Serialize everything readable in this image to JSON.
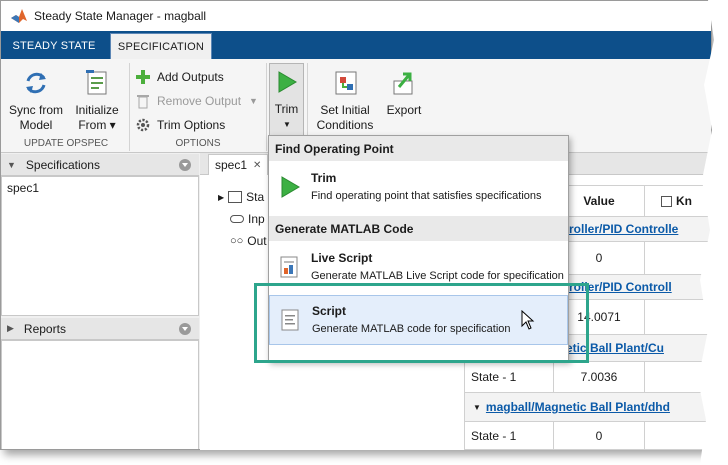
{
  "window": {
    "title": "Steady State Manager - magball"
  },
  "tabs": [
    {
      "label": "STEADY STATE",
      "active": false
    },
    {
      "label": "SPECIFICATION",
      "active": true
    }
  ],
  "toolstrip": {
    "sync": {
      "line1": "Sync from",
      "line2": "Model"
    },
    "initialize": {
      "line1": "Initialize",
      "line2": "From ▾"
    },
    "add_outputs": "Add Outputs",
    "remove_output": "Remove Output",
    "trim_options": "Trim Options",
    "trim": {
      "label": "Trim"
    },
    "set_initial": {
      "line1": "Set Initial",
      "line2": "Conditions"
    },
    "export": "Export",
    "groups": {
      "update": "UPDATE OPSPEC",
      "options": "OPTIONS"
    }
  },
  "specifications_panel": {
    "title": "Specifications",
    "items": [
      "spec1"
    ]
  },
  "reports_panel": {
    "title": "Reports"
  },
  "document": {
    "tab_label": "spec1",
    "tree": [
      "Sta",
      "Inp",
      "Out"
    ],
    "columns": {
      "value": "Value",
      "known": "Kn"
    },
    "rows": [
      {
        "kind": "link",
        "text": "roller/PID Controlle"
      },
      {
        "kind": "value",
        "value": "0"
      },
      {
        "kind": "link",
        "text": "roller/PID Controll"
      },
      {
        "kind": "value",
        "value": "14.0071"
      },
      {
        "kind": "block",
        "text": "magball/Magnetic Ball Plant/Cu"
      },
      {
        "kind": "state",
        "name": "State - 1",
        "value": "7.0036"
      },
      {
        "kind": "block",
        "text": "magball/Magnetic Ball Plant/dhd"
      },
      {
        "kind": "state",
        "name": "State - 1",
        "value": "0"
      }
    ]
  },
  "menu": {
    "section1": "Find Operating Point",
    "trim": {
      "title": "Trim",
      "desc": "Find operating point that satisfies specifications"
    },
    "section2": "Generate MATLAB Code",
    "live_script": {
      "title": "Live Script",
      "desc": "Generate MATLAB Live Script code for specification"
    },
    "script": {
      "title": "Script",
      "desc": "Generate MATLAB code for specification"
    }
  },
  "colors": {
    "tabbar": "#0d4f8a",
    "highlight": "#2da58c",
    "link": "#0b5aa8",
    "trim_green": "#3cb043"
  }
}
